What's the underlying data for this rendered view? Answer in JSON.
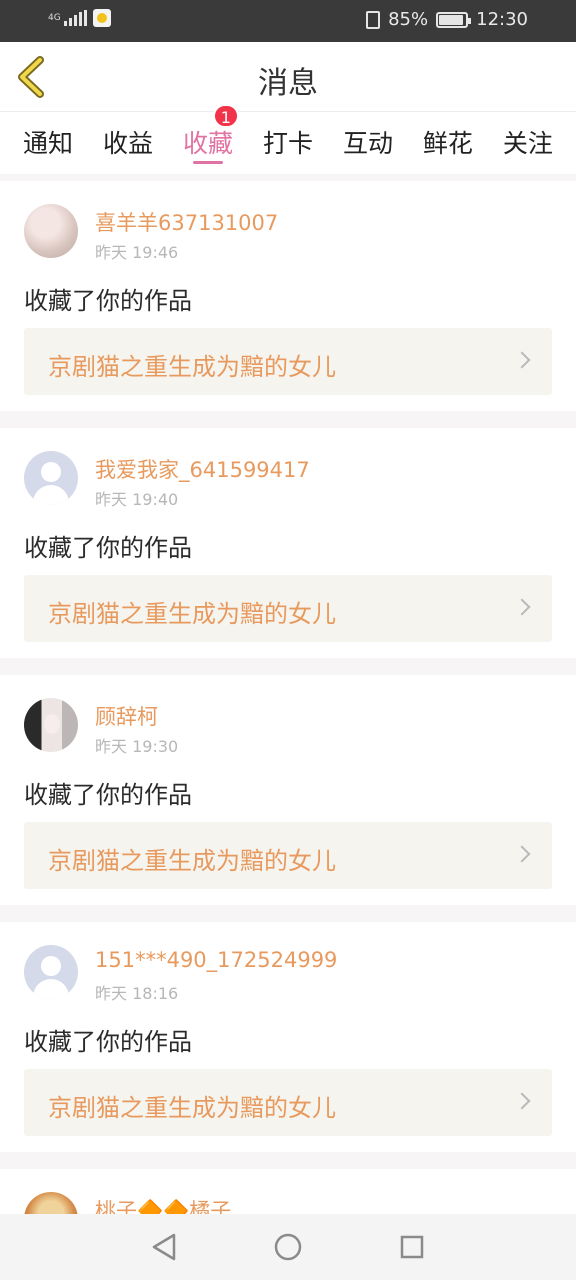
{
  "status_bar": {
    "network": "4G",
    "battery": "85%",
    "time": "12:30"
  },
  "header": {
    "title": "消息"
  },
  "tabs": [
    {
      "label": "通知",
      "active": false
    },
    {
      "label": "收益",
      "active": false
    },
    {
      "label": "收藏",
      "active": true,
      "badge": "1"
    },
    {
      "label": "打卡",
      "active": false
    },
    {
      "label": "互动",
      "active": false
    },
    {
      "label": "鲜花",
      "active": false
    },
    {
      "label": "关注",
      "active": false
    }
  ],
  "messages": [
    {
      "name": "喜羊羊637131007",
      "time": "昨天 19:46",
      "action": "收藏了你的作品",
      "work": "京剧猫之重生成为黯的女儿"
    },
    {
      "name": "我爱我家_641599417",
      "time": "昨天 19:40",
      "action": "收藏了你的作品",
      "work": "京剧猫之重生成为黯的女儿"
    },
    {
      "name": "顾辞柯",
      "time": "昨天 19:30",
      "action": "收藏了你的作品",
      "work": "京剧猫之重生成为黯的女儿"
    },
    {
      "name": "151***490_172524999",
      "time": "昨天 18:16",
      "action": "收藏了你的作品",
      "work": "京剧猫之重生成为黯的女儿"
    },
    {
      "name": "桃子🔶🔶橘子"
    }
  ],
  "colors": {
    "accent_pink": "#e173a3",
    "name_orange": "#e89a5e",
    "badge_red": "#f2344a"
  }
}
